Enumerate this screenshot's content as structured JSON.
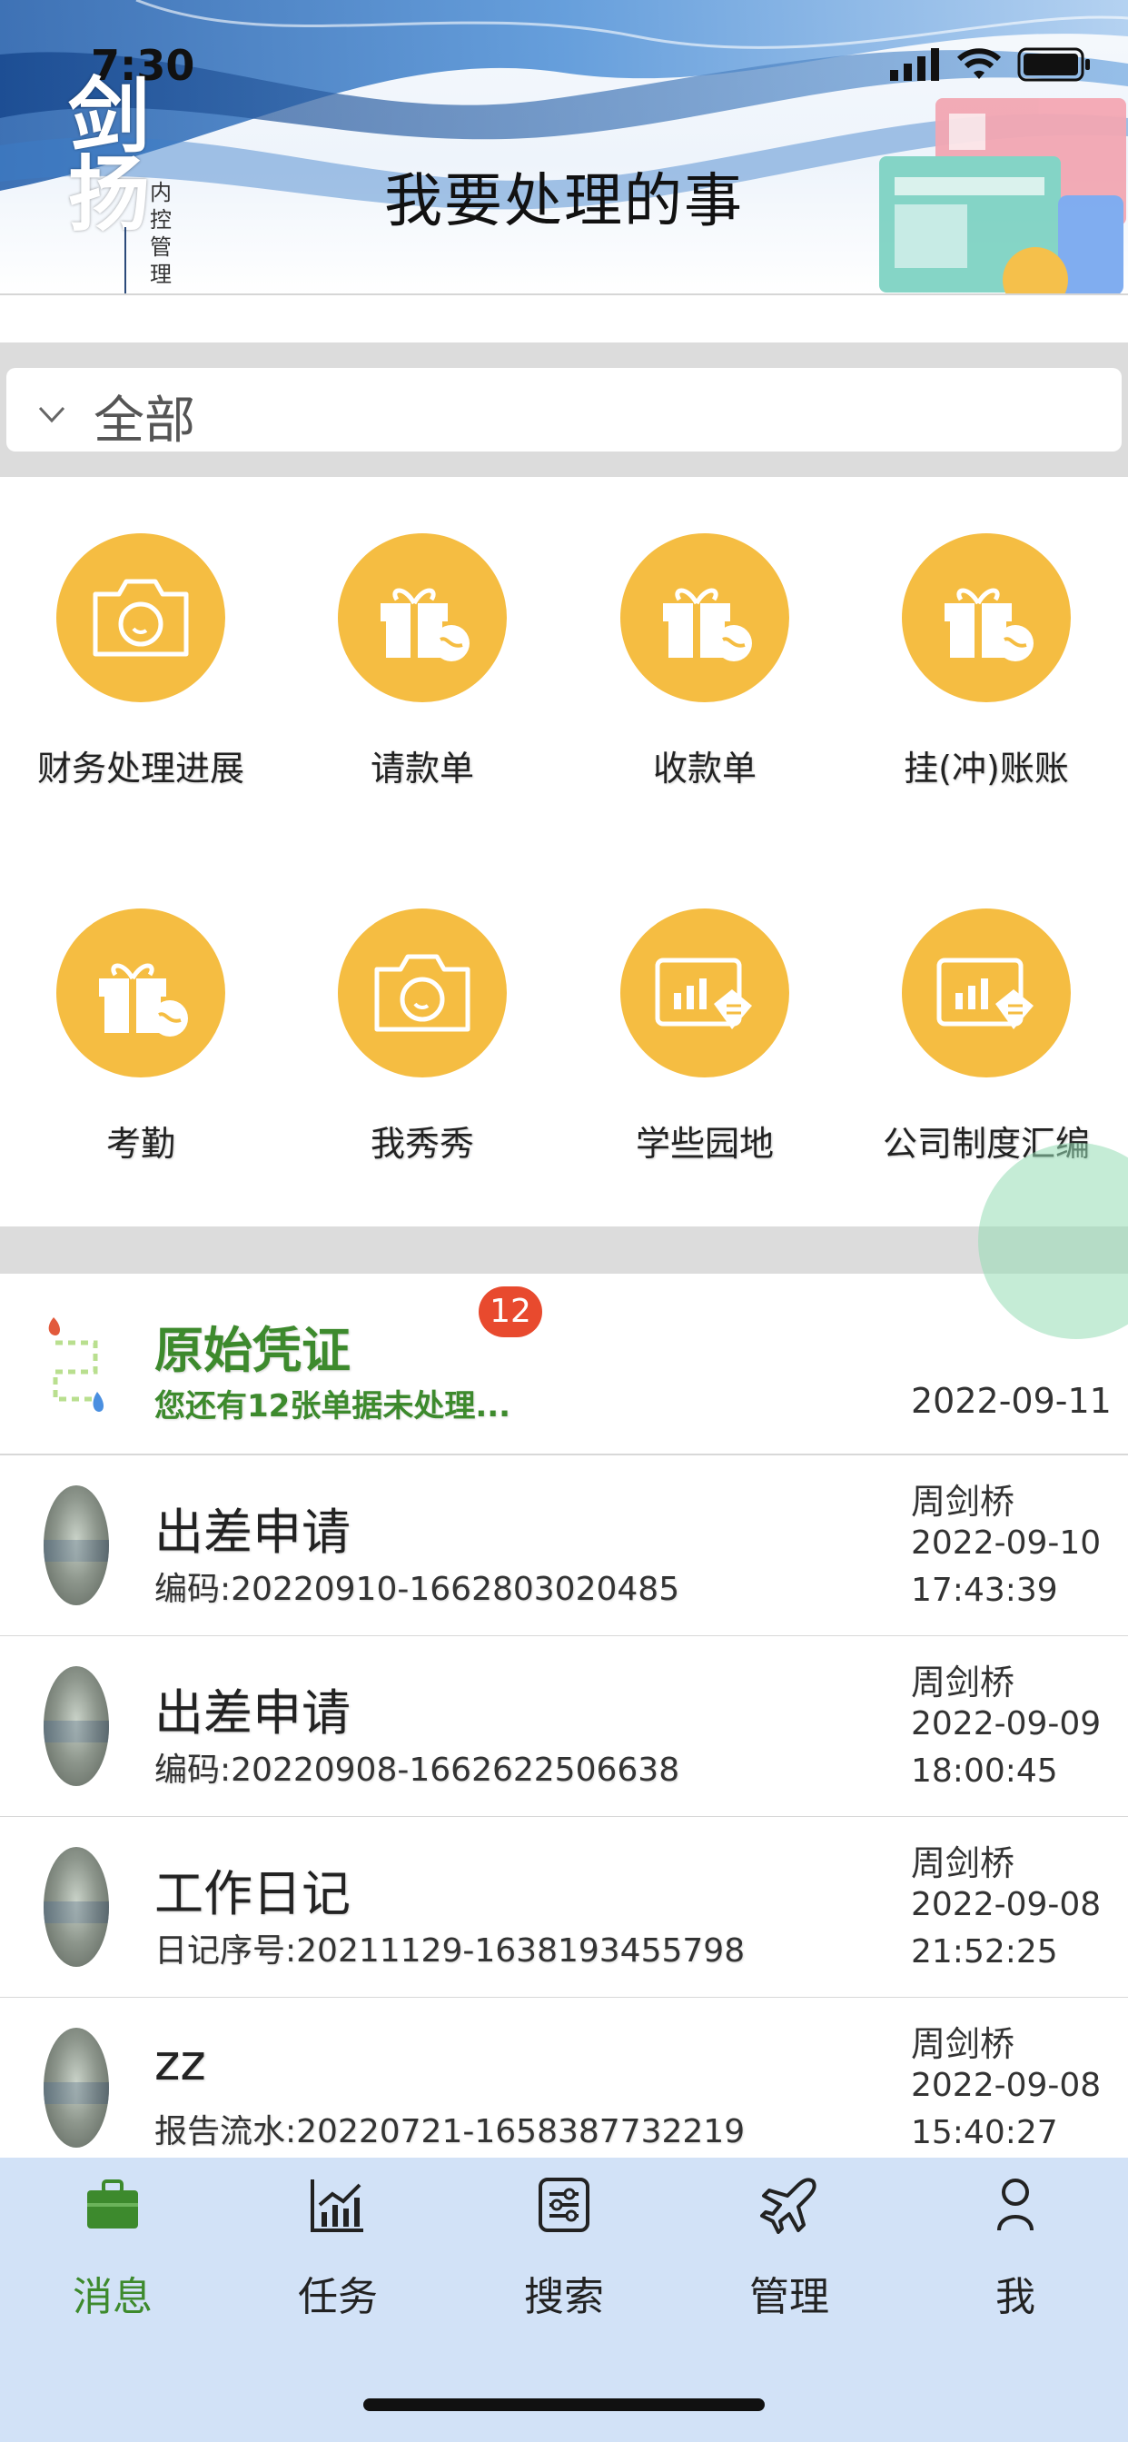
{
  "status_bar": {
    "time": "7:30"
  },
  "header": {
    "logo_glyph": "剑扬",
    "logo_subtitle": "内控管理",
    "title": "我要处理的事"
  },
  "filter": {
    "label": "全部",
    "icon": "chevron-down-icon"
  },
  "grid": [
    {
      "label": "财务处理进展",
      "icon": "camera-icon"
    },
    {
      "label": "请款单",
      "icon": "gift-icon"
    },
    {
      "label": "收款单",
      "icon": "gift-icon"
    },
    {
      "label": "挂(冲)账账",
      "icon": "gift-icon"
    },
    {
      "label": "考勤",
      "icon": "gift-icon"
    },
    {
      "label": "我秀秀",
      "icon": "camera-icon"
    },
    {
      "label": "学些园地",
      "icon": "chart-tag-icon"
    },
    {
      "label": "公司制度汇编",
      "icon": "chart-tag-icon"
    }
  ],
  "list": {
    "first": {
      "title": "原始凭证",
      "subtitle": "您还有12张单据未处理...",
      "date": "2022-09-11",
      "badge": "12"
    },
    "items": [
      {
        "title": "出差申请",
        "subtitle": "编码:20220910-1662803020485",
        "author": "周剑桥",
        "date": "2022-09-10",
        "time": "17:43:39"
      },
      {
        "title": "出差申请",
        "subtitle": "编码:20220908-1662622506638",
        "author": "周剑桥",
        "date": "2022-09-09",
        "time": "18:00:45"
      },
      {
        "title": "工作日记",
        "subtitle": "日记序号:20211129-1638193455798",
        "author": "周剑桥",
        "date": "2022-09-08",
        "time": "21:52:25"
      },
      {
        "title": "zz",
        "subtitle": "报告流水:20220721-1658387732219",
        "author": "周剑桥",
        "date": "2022-09-08",
        "time": "15:40:27"
      }
    ]
  },
  "tabbar": [
    {
      "label": "消息",
      "icon": "briefcase-icon",
      "active": true
    },
    {
      "label": "任务",
      "icon": "chart-icon",
      "active": false
    },
    {
      "label": "搜索",
      "icon": "settings-panel-icon",
      "active": false
    },
    {
      "label": "管理",
      "icon": "airplane-icon",
      "active": false
    },
    {
      "label": "我",
      "icon": "person-icon",
      "active": false
    }
  ],
  "colors": {
    "accent_green": "#3d8a2d",
    "icon_yellow": "#f5bd42",
    "badge_red": "#e84a2e",
    "tabbar_bg": "#d2e2f7"
  }
}
